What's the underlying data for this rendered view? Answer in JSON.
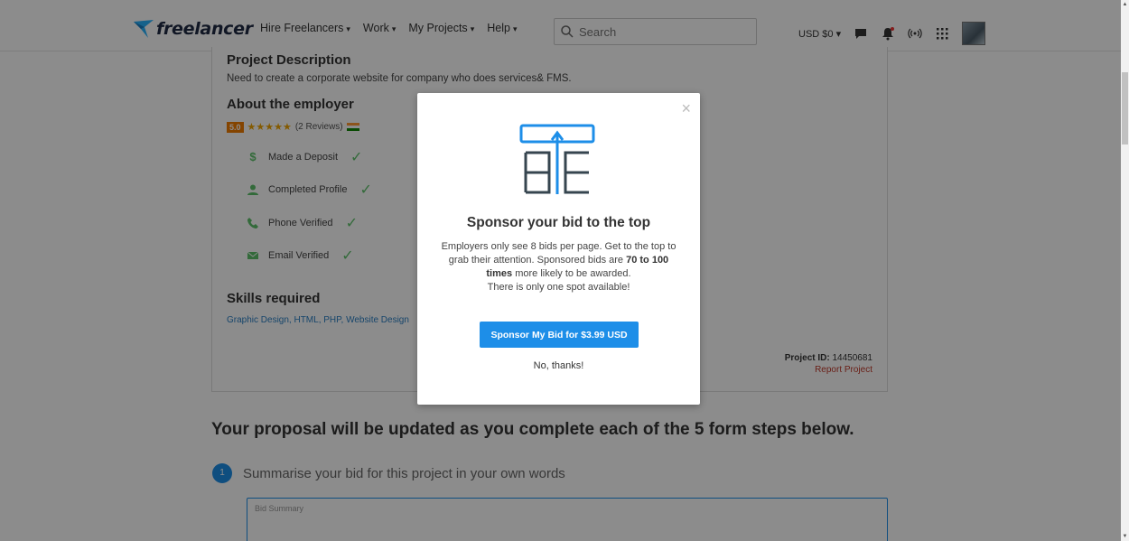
{
  "navbar": {
    "logo_text": "freelancer",
    "menu": [
      {
        "label": "Hire Freelancers",
        "caret": "▾"
      },
      {
        "label": "Work",
        "caret": "▾"
      },
      {
        "label": "My Projects",
        "caret": "▾"
      },
      {
        "label": "Help",
        "caret": "▾"
      }
    ],
    "search_placeholder": "Search",
    "balance": "USD $0",
    "balance_caret": "▾"
  },
  "project": {
    "description_heading": "Project Description",
    "description_text": "Need to create a corporate website for company who does services& FMS.",
    "employer_heading": "About the employer",
    "rating_value": "5.0",
    "stars": "★★★★★",
    "reviews": "(2 Reviews)",
    "verifications": [
      {
        "label": "Made a Deposit",
        "icon": "dollar-icon"
      },
      {
        "label": "Completed Profile",
        "icon": "user-icon"
      },
      {
        "label": "Phone Verified",
        "icon": "phone-icon"
      },
      {
        "label": "Email Verified",
        "icon": "email-icon"
      }
    ],
    "check": "✓",
    "skills_heading": "Skills required",
    "skills_text": "Graphic Design, HTML, PHP, Website Design",
    "project_id_label": "Project ID:",
    "project_id_value": "14450681",
    "report_label": "Report Project"
  },
  "proposal": {
    "heading": "Your proposal will be updated as you complete each of the 5 form steps below.",
    "step_number": "1",
    "step_title": "Summarise your bid for this project in your own words",
    "bid_placeholder": "Bid Summary"
  },
  "modal": {
    "close": "×",
    "title": "Sponsor your bid to the top",
    "desc_part1": "Employers only see 8 bids per page. Get to the top to grab their attention. Sponsored bids are ",
    "desc_bold": "70 to 100 times",
    "desc_part2": " more likely to be awarded.",
    "desc_line2": "There is only one spot available!",
    "sponsor_button": "Sponsor My Bid for $3.99 USD",
    "no_thanks": "No, thanks!"
  },
  "colors": {
    "accent": "#1d8ee8",
    "check": "#5dc26a",
    "report": "#c0392b",
    "rating_badge": "#f07c00"
  }
}
